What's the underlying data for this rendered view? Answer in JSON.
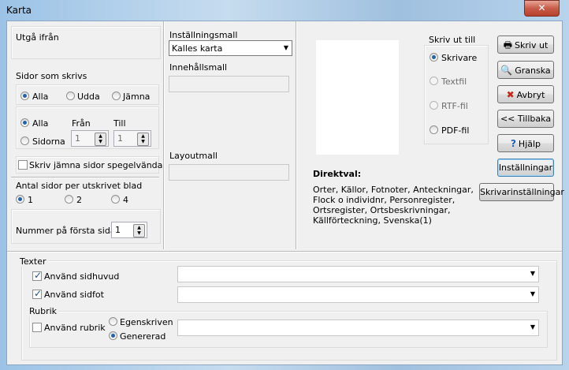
{
  "window": {
    "title": "Karta",
    "close_label": "✕"
  },
  "left": {
    "utga_fran": "Utgå ifrån",
    "sidor_som_skrivs": "Sidor som skrivs",
    "radio_alla": "Alla",
    "radio_udda": "Udda",
    "radio_jamna": "Jämna",
    "range_alla": "Alla",
    "range_sidorna": "Sidorna",
    "fran_label": "Från",
    "till_label": "Till",
    "fran_value": "1",
    "till_value": "1",
    "mirror_label": "Skriv jämna sidor spegelvända",
    "per_blad_label": "Antal sidor per utskrivet blad",
    "per_blad_1": "1",
    "per_blad_2": "2",
    "per_blad_4": "4",
    "forsta_sidan_label": "Nummer på första sidan",
    "forsta_sidan_value": "1"
  },
  "middle": {
    "installningsmall_label": "Inställningsmall",
    "installningsmall_value": "Kalles karta",
    "innehallsmall_label": "Innehållsmall",
    "layoutmall_label": "Layoutmall"
  },
  "right": {
    "skriv_ut_till": "Skriv ut till",
    "opt_skrivare": "Skrivare",
    "opt_textfil": "Textfil",
    "opt_rtf": "RTF-fil",
    "opt_pdf": "PDF-fil",
    "direktval_title": "Direktval:",
    "direktval_lines": [
      "Orter, Källor, Fotnoter, Anteckningar,",
      "Flock o individnr, Personregister,",
      "Ortsregister, Ortsbeskrivningar,",
      "Källförteckning, Svenska(1)"
    ]
  },
  "buttons": {
    "skriv_ut": "Skriv ut",
    "granska": "Granska",
    "avbryt": "Avbryt",
    "tillbaka": "<< Tillbaka",
    "hjalp": "Hjälp",
    "installningar": "Inställningar",
    "skrivarinstallningar": "Skrivarinställningar"
  },
  "bottom": {
    "texter": "Texter",
    "sidhuvud": "Använd sidhuvud",
    "sidfot": "Använd sidfot",
    "rubrik": "Rubrik",
    "anvand_rubrik": "Använd rubrik",
    "egenskriven": "Egenskriven",
    "genererad": "Genererad"
  },
  "icons": {
    "printer": "printer-icon",
    "magnifier": "magnifier-icon",
    "cancel": "cancel-icon",
    "help": "help-icon"
  }
}
